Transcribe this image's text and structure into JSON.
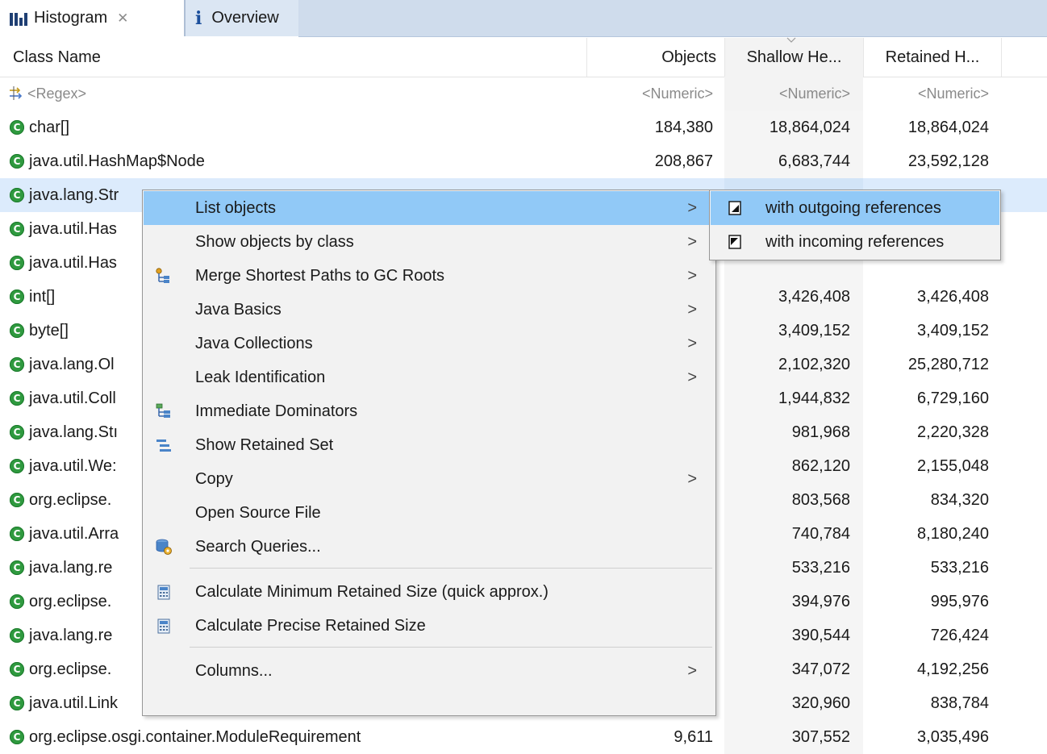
{
  "tabs": [
    {
      "label": "Histogram",
      "icon": "histogram-icon",
      "active": true,
      "closable": true
    },
    {
      "label": "Overview",
      "icon": "info-icon",
      "active": false
    }
  ],
  "columns": {
    "class_name": "Class Name",
    "objects": "Objects",
    "shallow": "Shallow He...",
    "retained": "Retained H..."
  },
  "filters": {
    "class_name": "<Regex>",
    "objects": "<Numeric>",
    "shallow": "<Numeric>",
    "retained": "<Numeric>"
  },
  "rows": [
    {
      "name": "char[]",
      "objects": "184,380",
      "shallow": "18,864,024",
      "retained": "18,864,024"
    },
    {
      "name": "java.util.HashMap$Node",
      "objects": "208,867",
      "shallow": "6,683,744",
      "retained": "23,592,128"
    },
    {
      "name": "java.lang.Str",
      "objects": "",
      "shallow": "",
      "retained": "",
      "selected": true
    },
    {
      "name": "java.util.Has",
      "objects": "",
      "shallow": "",
      "retained": ""
    },
    {
      "name": "java.util.Has",
      "objects": "",
      "shallow": "",
      "retained": ""
    },
    {
      "name": "int[]",
      "objects": "",
      "shallow": "3,426,408",
      "retained": "3,426,408"
    },
    {
      "name": "byte[]",
      "objects": "",
      "shallow": "3,409,152",
      "retained": "3,409,152"
    },
    {
      "name": "java.lang.Ol",
      "objects": "",
      "shallow": "2,102,320",
      "retained": "25,280,712"
    },
    {
      "name": "java.util.Coll",
      "objects": "",
      "shallow": "1,944,832",
      "retained": "6,729,160"
    },
    {
      "name": "java.lang.Stı",
      "objects": "",
      "shallow": "981,968",
      "retained": "2,220,328"
    },
    {
      "name": "java.util.We:",
      "objects": "",
      "shallow": "862,120",
      "retained": "2,155,048"
    },
    {
      "name": "org.eclipse.",
      "objects": "",
      "shallow": "803,568",
      "retained": "834,320"
    },
    {
      "name": "java.util.Arra",
      "objects": "",
      "shallow": "740,784",
      "retained": "8,180,240"
    },
    {
      "name": "java.lang.re",
      "objects": "",
      "shallow": "533,216",
      "retained": "533,216"
    },
    {
      "name": "org.eclipse.",
      "objects": "",
      "shallow": "394,976",
      "retained": "995,976"
    },
    {
      "name": "java.lang.re",
      "objects": "",
      "shallow": "390,544",
      "retained": "726,424"
    },
    {
      "name": "org.eclipse.",
      "objects": "",
      "shallow": "347,072",
      "retained": "4,192,256"
    },
    {
      "name": "java.util.Link",
      "objects": "",
      "shallow": "320,960",
      "retained": "838,784"
    },
    {
      "name": "org.eclipse.osgi.container.ModuleRequirement",
      "objects": "9,611",
      "shallow": "307,552",
      "retained": "3,035,496"
    }
  ],
  "context_menu": {
    "items": [
      {
        "label": "List objects",
        "submenu": true,
        "highlighted": true
      },
      {
        "label": "Show objects by class",
        "submenu": true
      },
      {
        "label": "Merge Shortest Paths to GC Roots",
        "submenu": true,
        "icon": "gc-roots-paths-icon"
      },
      {
        "label": "Java Basics",
        "submenu": true
      },
      {
        "label": "Java Collections",
        "submenu": true
      },
      {
        "label": "Leak Identification",
        "submenu": true
      },
      {
        "label": "Immediate Dominators",
        "submenu": false,
        "icon": "dominators-icon"
      },
      {
        "label": "Show Retained Set",
        "submenu": false,
        "icon": "retained-set-icon"
      },
      {
        "label": "Copy",
        "submenu": true
      },
      {
        "label": "Open Source File",
        "submenu": false
      },
      {
        "label": "Search Queries...",
        "submenu": false,
        "icon": "search-queries-icon"
      },
      {
        "label": "Calculate Minimum Retained Size (quick approx.)",
        "submenu": false,
        "icon": "calculator-icon"
      },
      {
        "label": "Calculate Precise Retained Size",
        "submenu": false,
        "icon": "calculator-icon"
      },
      {
        "label": "Columns...",
        "submenu": true
      }
    ],
    "arrow_glyph": ">"
  },
  "submenu": {
    "items": [
      {
        "label": "with outgoing references",
        "icon": "outgoing-references-icon",
        "highlighted": true
      },
      {
        "label": "with incoming references",
        "icon": "incoming-references-icon"
      }
    ]
  },
  "colors": {
    "tab_bar": "#cfdcec",
    "selection": "#dcebfc",
    "menu_highlight": "#91c9f7",
    "class_icon": "#2f9a3f"
  }
}
